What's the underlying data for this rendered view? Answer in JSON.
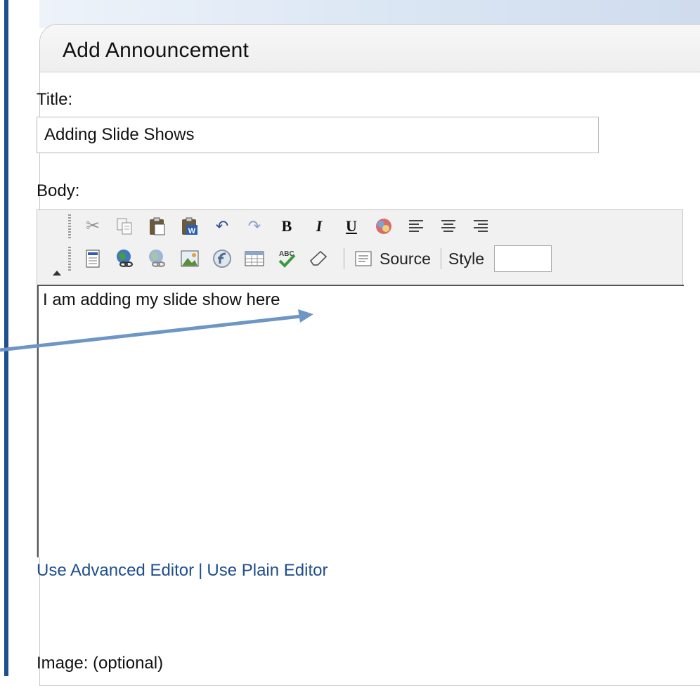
{
  "panel": {
    "title": "Add Announcement"
  },
  "title_field": {
    "label": "Title:",
    "value": "Adding Slide Shows"
  },
  "body_field": {
    "label": "Body:",
    "content": "I am adding my slide show here"
  },
  "toolbar": {
    "row1_icons": [
      "cut-icon",
      "copy-icon",
      "paste-icon",
      "paste-word-icon",
      "undo-icon",
      "redo-icon",
      "bold-icon",
      "italic-icon",
      "underline-icon",
      "remove-format-icon",
      "align-left-icon",
      "align-center-icon",
      "align-right-icon"
    ],
    "row2_icons": [
      "new-page-icon",
      "insert-link-icon",
      "remove-link-icon",
      "insert-image-icon",
      "insert-flash-icon",
      "insert-table-icon",
      "spell-check-icon",
      "eraser-icon"
    ],
    "bold": "B",
    "italic": "I",
    "underline": "U",
    "source_label": "Source",
    "style_label": "Style",
    "style_value": ""
  },
  "editor_links": {
    "advanced": "Use Advanced Editor",
    "separator": "|",
    "plain": "Use Plain Editor"
  },
  "image_field": {
    "label": "Image: (optional)"
  },
  "colors": {
    "accent_link": "#1e4e8c",
    "left_rule": "#1e4f91",
    "callout_arrow": "#6e96c4"
  }
}
